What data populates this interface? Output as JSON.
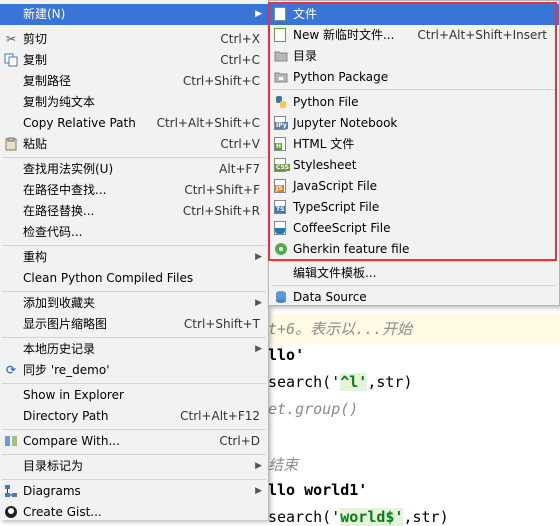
{
  "editor": {
    "line1": "t+6。表示以...开始",
    "line2": "llo'",
    "line3_pre": "search('",
    "line3_mid": "^l'",
    "line3_post": ",str)",
    "line4": "et.group()",
    "line5": "结束",
    "line6": "llo world1'",
    "line7_pre": "search('",
    "line7_mid": "world$'",
    "line7_post": ",str)"
  },
  "menu": {
    "new": "新建(N)",
    "cut": "剪切",
    "cut_sc": "Ctrl+X",
    "copy": "复制",
    "copy_sc": "Ctrl+C",
    "copy_path": "复制路径",
    "copy_path_sc": "Ctrl+Shift+C",
    "copy_plain": "复制为纯文本",
    "copy_rel": "Copy Relative Path",
    "copy_rel_sc": "Ctrl+Alt+Shift+C",
    "paste": "粘贴",
    "paste_sc": "Ctrl+V",
    "find_usages": "查找用法实例(U)",
    "find_usages_sc": "Alt+F7",
    "find_in_path": "在路径中查找...",
    "find_in_path_sc": "Ctrl+Shift+F",
    "replace_in_path": "在路径替换...",
    "replace_in_path_sc": "Ctrl+Shift+R",
    "inspect": "检查代码...",
    "refactor": "重构",
    "clean": "Clean Python Compiled Files",
    "add_fav": "添加到收藏夹",
    "thumbnails": "显示图片缩略图",
    "thumbnails_sc": "Ctrl+Shift+T",
    "local_history": "本地历史记录",
    "sync": "同步 're_demo'",
    "show_explorer": "Show in Explorer",
    "dir_path": "Directory Path",
    "dir_path_sc": "Ctrl+Alt+F12",
    "compare": "Compare With...",
    "compare_sc": "Ctrl+D",
    "mark_dir": "目录标记为",
    "diagrams": "Diagrams",
    "gist": "Create Gist..."
  },
  "submenu": {
    "file": "文件",
    "scratch": "New 新临时文件...",
    "scratch_sc": "Ctrl+Alt+Shift+Insert",
    "directory": "目录",
    "python_package": "Python Package",
    "python_file": "Python File",
    "jupyter": "Jupyter Notebook",
    "html": "HTML 文件",
    "stylesheet": "Stylesheet",
    "javascript": "JavaScript File",
    "typescript": "TypeScript File",
    "coffeescript": "CoffeeScript File",
    "gherkin": "Gherkin feature file",
    "edit_templates": "编辑文件模板...",
    "data_source": "Data Source"
  },
  "colors": {
    "selection": "#3875d7",
    "highlight_box": "#e8323c"
  }
}
